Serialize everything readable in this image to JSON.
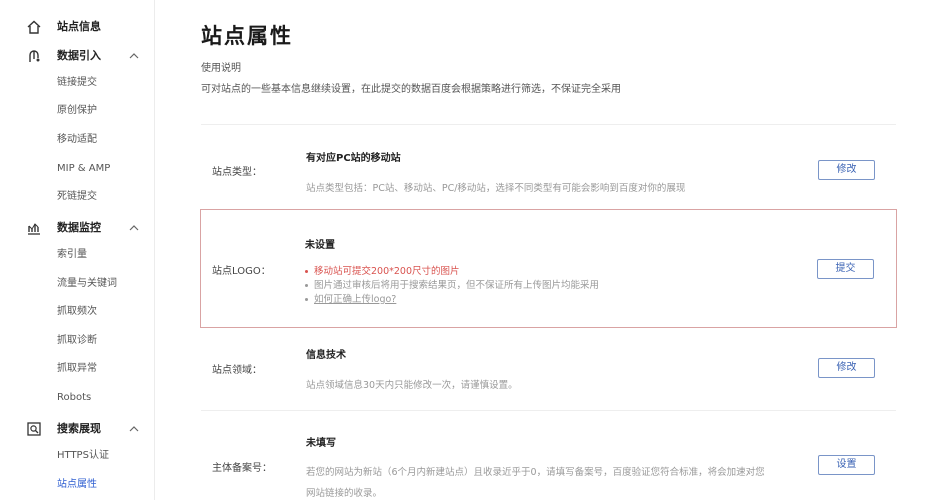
{
  "colors": {
    "accent": "#2f5fd1",
    "danger": "#d9534f",
    "highlight_border": "#d9a3a3",
    "button_border": "#7a95c8"
  },
  "sidebar": {
    "groups": [
      {
        "label": "站点信息",
        "icon": "home-icon"
      },
      {
        "label": "数据引入",
        "icon": "data-import-icon",
        "items": [
          "链接提交",
          "原创保护",
          "移动适配",
          "MIP & AMP",
          "死链提交"
        ]
      },
      {
        "label": "数据监控",
        "icon": "chart-icon",
        "items": [
          "索引量",
          "流量与关键词",
          "抓取频次",
          "抓取诊断",
          "抓取异常",
          "Robots"
        ]
      },
      {
        "label": "搜索展现",
        "icon": "search-display-icon",
        "items": [
          "HTTPS认证",
          "站点属性"
        ]
      }
    ]
  },
  "page": {
    "title": "站点属性",
    "usage_title": "使用说明",
    "usage_desc": "可对站点的一些基本信息继续设置，在此提交的数据百度会根据策略进行筛选，不保证完全采用"
  },
  "sections": {
    "type": {
      "label": "站点类型：",
      "value": "有对应PC站的移动站",
      "desc": "站点类型包括：PC站、移动站、PC/移动站，选择不同类型有可能会影响到百度对你的展现",
      "button": "修改"
    },
    "logo": {
      "label": "站点LOGO：",
      "value": "未设置",
      "bullets": [
        "移动站可提交200*200尺寸的图片",
        "图片通过审核后将用于搜索结果页，但不保证所有上传图片均能采用",
        "如何正确上传logo?"
      ],
      "button": "提交"
    },
    "domain": {
      "label": "站点领域：",
      "value": "信息技术",
      "desc": "站点领域信息30天内只能修改一次，请谨慎设置。",
      "button": "修改"
    },
    "icp": {
      "label": "主体备案号：",
      "value": "未填写",
      "desc1": "若您的网站为新站（6个月内新建站点）且收录近乎于0，请填写备案号，百度验证您符合标准，将会加速对您",
      "desc2": "网站链接的收录。",
      "button": "设置"
    }
  }
}
